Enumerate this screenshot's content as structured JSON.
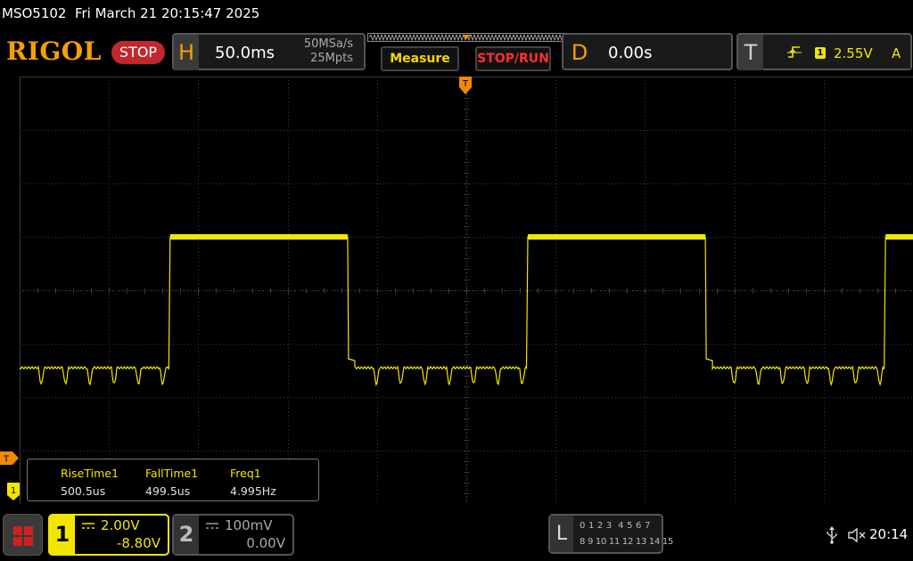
{
  "status": {
    "text": "MSO5102  Fri March 21 20:15:47 2025"
  },
  "top": {
    "logo": "RIGOL",
    "run_state": "STOP",
    "horizontal": {
      "letter": "H",
      "timebase": "50.0ms",
      "sample_rate": "50MSa/s",
      "memory_depth": "25Mpts"
    },
    "measure_button": "Measure",
    "stoprun_button": "STOP/RUN",
    "delay": {
      "letter": "D",
      "value": "0.00s"
    },
    "trigger": {
      "letter": "T",
      "edge": "rising-edge-icon",
      "source": "1",
      "level": "2.55V",
      "mode": "A"
    }
  },
  "colors": {
    "ch1": "#f2e600",
    "brand": "#f5a000",
    "stop": "#c0282d",
    "grid": "#3c3c3c",
    "trigger_marker": "#f08a00"
  },
  "markers": {
    "trigger_position": "T",
    "trigger_level": "T",
    "ch1_ground": "1"
  },
  "measurements": [
    {
      "name": "RiseTime1",
      "value": "500.5us"
    },
    {
      "name": "FallTime1",
      "value": "499.5us"
    },
    {
      "name": "Freq1",
      "value": "4.995Hz"
    }
  ],
  "bottom": {
    "ch1": {
      "number": "1",
      "scale": "2.00V",
      "offset": "-8.80V"
    },
    "ch2": {
      "number": "2",
      "scale": "100mV",
      "offset": "0.00V"
    },
    "la": {
      "letter": "L",
      "row1": "0 1 2 3  4 5 6 7",
      "row2": "8 9 10 11 12 13 14 15"
    },
    "clock": "20:14"
  },
  "icons": {
    "home": "home-grid-icon",
    "usb": "usb-icon",
    "sound": "speaker-muted-icon",
    "coupling": "dc-coupling-icon"
  },
  "waveform": {
    "channel": "1",
    "frequency_hz": 4.995,
    "duty_cycle": 0.5,
    "time_per_div_ms": 50,
    "volts_per_div": 2.0,
    "offset_v": -8.8,
    "low_level_div": 2.55,
    "high_level_div": 5.0,
    "horizontal_divisions": 10,
    "vertical_divisions": 8,
    "first_rising_edge_div": 1.67,
    "low_ripple_period_ms": 13.6
  }
}
